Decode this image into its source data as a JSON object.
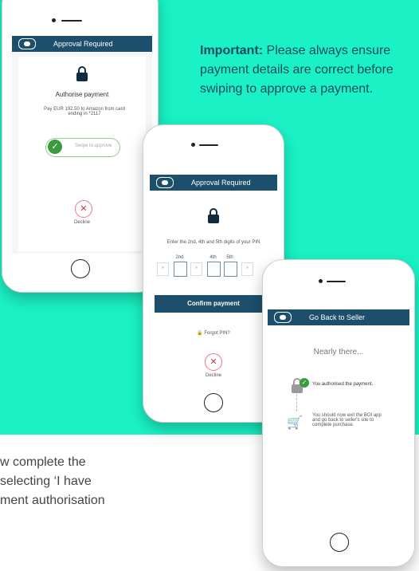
{
  "note": {
    "important_label": "Important:",
    "text": " Please always ensure payment details are correct before swiping to approve a payment."
  },
  "bottom_lines": [
    "w complete the",
    "selecting ‘I have",
    "ment authorisation"
  ],
  "phone1": {
    "bar_title": "Approval Required",
    "heading": "Authorise payment",
    "description": "Pay EUR 192.50 to Amazon from card ending in *2117",
    "swipe_label": "Swipe to approve",
    "decline_label": "Decline",
    "logo_icon": "bank-logo-icon",
    "lock_icon": "lock-icon",
    "decline_icon": "close-icon"
  },
  "phone2": {
    "bar_title": "Approval Required",
    "instruction": "Enter the 2nd, 4th and 5th digits of your PIN",
    "pin_labels": [
      "2nd",
      "4th",
      "5th"
    ],
    "pin_masked": "*",
    "confirm_label": "Confirm payment",
    "forgot_label": "Forgot PIN?",
    "decline_label": "Decline"
  },
  "phone3": {
    "bar_title": "Go Back to Seller",
    "heading": "Nearly there...",
    "step1": "You authorised the payment.",
    "step2": "You should now exit the BOI app and go back to seller's site to complete purchase.",
    "cart_icon": "shopping-cart-icon"
  },
  "colors": {
    "teal": "#1af2c5",
    "navy": "#1b4f6b",
    "green": "#3c9b3c",
    "red": "#d0334d"
  }
}
